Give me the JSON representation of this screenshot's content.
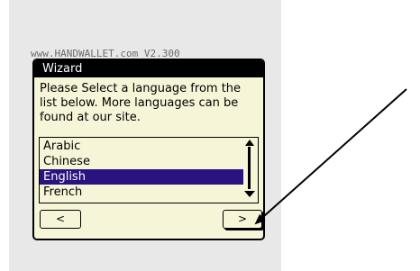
{
  "background_banner": "www.HANDWALLET.com V2.300",
  "dialog": {
    "title": "Wizard",
    "message": "Please Select a language from the list below. More languages can be found at our site.",
    "list": {
      "items": [
        "Arabic",
        "Chinese",
        "English",
        "French"
      ],
      "selected": "English"
    },
    "prev_button": "<",
    "next_button": ">"
  },
  "colors": {
    "dialog_bg": "#f7f5d8",
    "selection": "#2a1280",
    "titlebar": "#000000"
  }
}
